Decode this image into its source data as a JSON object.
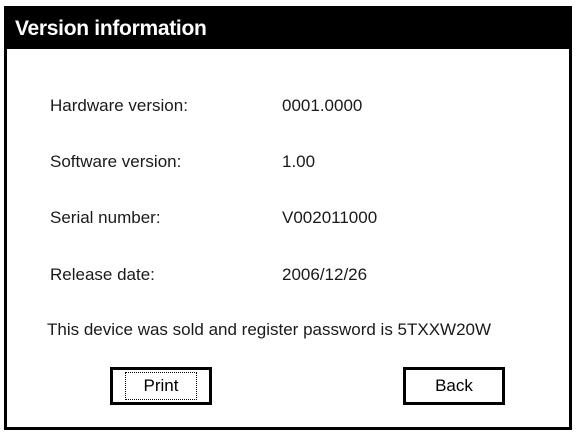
{
  "window": {
    "title": "Version information"
  },
  "info": {
    "hardware_label": "Hardware version:",
    "hardware_value": "0001.0000",
    "software_label": "Software version:",
    "software_value": "1.00",
    "serial_label": "Serial number:",
    "serial_value": "V002011000",
    "release_label": "Release date:",
    "release_value": "2006/12/26"
  },
  "note": {
    "text": "This device was sold and register password is 5TXXW20W"
  },
  "buttons": {
    "print_label": "Print",
    "back_label": "Back"
  }
}
